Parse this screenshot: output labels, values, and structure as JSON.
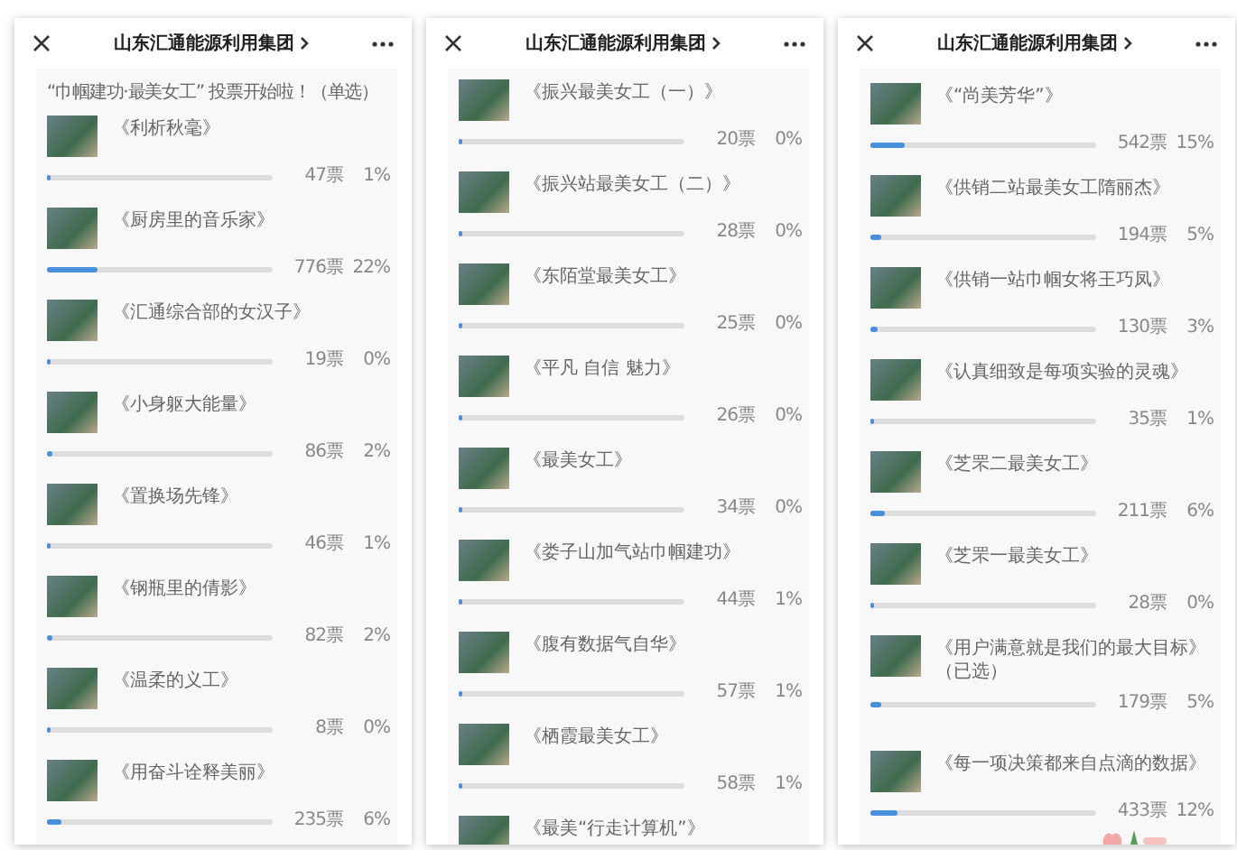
{
  "panels": [
    {
      "title": "山东汇通能源利用集团",
      "intro": "“巾帼建功·最美女工” 投票开始啦！（单选）",
      "decoration": false,
      "items": [
        {
          "title": "《利析秋毫》",
          "votes": "47票",
          "percent": "1%",
          "level": 0.01
        },
        {
          "title": "《厨房里的音乐家》",
          "votes": "776票",
          "percent": "22%",
          "level": 0.22
        },
        {
          "title": "《汇通综合部的女汉子》",
          "votes": "19票",
          "percent": "0%",
          "level": 0
        },
        {
          "title": "《小身躯大能量》",
          "votes": "86票",
          "percent": "2%",
          "level": 0.02
        },
        {
          "title": "《置换场先锋》",
          "votes": "46票",
          "percent": "1%",
          "level": 0.01
        },
        {
          "title": "《钢瓶里的倩影》",
          "votes": "82票",
          "percent": "2%",
          "level": 0.02
        },
        {
          "title": "《温柔的义工》",
          "votes": "8票",
          "percent": "0%",
          "level": 0
        },
        {
          "title": "《用奋斗诠释美丽》",
          "votes": "235票",
          "percent": "6%",
          "level": 0.06
        }
      ]
    },
    {
      "title": "山东汇通能源利用集团",
      "decoration": false,
      "items": [
        {
          "title": "《振兴最美女工（一）》",
          "votes": "20票",
          "percent": "0%",
          "level": 0
        },
        {
          "title": "《振兴站最美女工（二）》",
          "votes": "28票",
          "percent": "0%",
          "level": 0
        },
        {
          "title": "《东陌堂最美女工》",
          "votes": "25票",
          "percent": "0%",
          "level": 0
        },
        {
          "title": "《平凡  自信  魅力》",
          "votes": "26票",
          "percent": "0%",
          "level": 0
        },
        {
          "title": "《最美女工》",
          "votes": "34票",
          "percent": "0%",
          "level": 0
        },
        {
          "title": "《娄子山加气站巾帼建功》",
          "votes": "44票",
          "percent": "1%",
          "level": 0.01
        },
        {
          "title": "《腹有数据气自华》",
          "votes": "57票",
          "percent": "1%",
          "level": 0.01
        },
        {
          "title": "《栖霞最美女工》",
          "votes": "58票",
          "percent": "1%",
          "level": 0.01
        },
        {
          "title": "《最美“行走计算机”》"
        }
      ]
    },
    {
      "title": "山东汇通能源利用集团",
      "decoration": true,
      "items": [
        {
          "title": "《“尚美芳华”》",
          "votes": "542票",
          "percent": "15%",
          "level": 0.15
        },
        {
          "title": "《供销二站最美女工隋丽杰》",
          "votes": "194票",
          "percent": "5%",
          "level": 0.05
        },
        {
          "title": "《供销一站巾帼女将王巧凤》",
          "votes": "130票",
          "percent": "3%",
          "level": 0.03
        },
        {
          "title": "《认真细致是每项实验的灵魂》",
          "votes": "35票",
          "percent": "1%",
          "level": 0.01
        },
        {
          "title": "《芝罘二最美女工》",
          "votes": "211票",
          "percent": "6%",
          "level": 0.06
        },
        {
          "title": "《芝罘一最美女工》",
          "votes": "28票",
          "percent": "0%",
          "level": 0
        },
        {
          "title": "《用户满意就是我们的最大目标》（已选）",
          "votes": "179票",
          "percent": "5%",
          "level": 0.05
        },
        {
          "title": "《每一项决策都来自点滴的数据》",
          "votes": "433票",
          "percent": "12%",
          "level": 0.12
        }
      ]
    }
  ]
}
